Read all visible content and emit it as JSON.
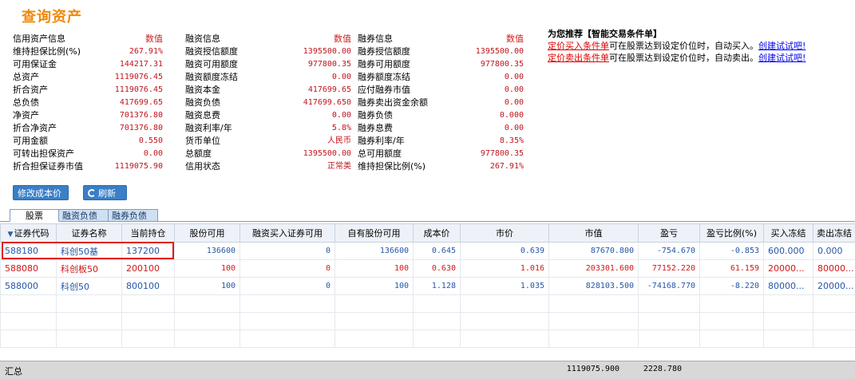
{
  "title": "查询资产",
  "info": {
    "col1": {
      "header": {
        "label": "信用资产信息",
        "value": "数值"
      },
      "rows": [
        {
          "label": "维持担保比例(%)",
          "value": "267.91%"
        },
        {
          "label": "可用保证金",
          "value": "144217.31"
        },
        {
          "label": "总资产",
          "value": "1119076.45"
        },
        {
          "label": "折合资产",
          "value": "1119076.45"
        },
        {
          "label": "总负债",
          "value": "417699.65"
        },
        {
          "label": "净资产",
          "value": "701376.80"
        },
        {
          "label": "折合净资产",
          "value": "701376.80"
        },
        {
          "label": "可用金额",
          "value": "0.550"
        },
        {
          "label": "可转出担保资产",
          "value": "0.00"
        },
        {
          "label": "折合担保证券市值",
          "value": "1119075.90"
        }
      ]
    },
    "col2": {
      "header": {
        "label": "融资信息",
        "value": "数值"
      },
      "rows": [
        {
          "label": "融资授信额度",
          "value": "1395500.00"
        },
        {
          "label": "融资可用额度",
          "value": "977800.35"
        },
        {
          "label": "融资额度冻结",
          "value": "0.00"
        },
        {
          "label": "融资本金",
          "value": "417699.65"
        },
        {
          "label": "融资负债",
          "value": "417699.650"
        },
        {
          "label": "融资息费",
          "value": "0.00"
        },
        {
          "label": "融资利率/年",
          "value": "5.8%"
        },
        {
          "label": "货币单位",
          "value": "人民币"
        },
        {
          "label": "总额度",
          "value": "1395500.00"
        },
        {
          "label": "信用状态",
          "value": "正常类"
        }
      ]
    },
    "col3": {
      "header": {
        "label": "融券信息",
        "value": "数值"
      },
      "rows": [
        {
          "label": "融券授信额度",
          "value": "1395500.00"
        },
        {
          "label": "融券可用额度",
          "value": "977800.35"
        },
        {
          "label": "融券额度冻结",
          "value": "0.00"
        },
        {
          "label": "应付融券市值",
          "value": "0.00"
        },
        {
          "label": "融券卖出资金余额",
          "value": "0.00"
        },
        {
          "label": "融券负债",
          "value": "0.000"
        },
        {
          "label": "融券息费",
          "value": "0.00"
        },
        {
          "label": "融券利率/年",
          "value": "8.35%"
        },
        {
          "label": "总可用额度",
          "value": "977800.35"
        },
        {
          "label": "维持担保比例(%)",
          "value": "267.91%"
        }
      ]
    }
  },
  "recommend": {
    "title": "为您推荐【智能交易条件单】",
    "line1": {
      "link": "定价买入条件单",
      "text": "可在股票达到设定价位时，自动买入。",
      "action": "创建试试吧!"
    },
    "line2": {
      "link": "定价卖出条件单",
      "text": "可在股票达到设定价位时，自动卖出。",
      "action": "创建试试吧!"
    }
  },
  "buttons": {
    "edit_cost": "修改成本价",
    "refresh": "刷新"
  },
  "tabs": [
    "股票",
    "融资负债",
    "融券负债"
  ],
  "table": {
    "columns": [
      "证券代码",
      "证券名称",
      "当前持仓",
      "股份可用",
      "融资买入证券可用",
      "自有股份可用",
      "成本价",
      "市价",
      "市值",
      "盈亏",
      "盈亏比例(%)",
      "买入冻结",
      "卖出冻结"
    ],
    "rows": [
      {
        "code": "588180",
        "name": "科创50基",
        "position": "137200",
        "available": "136600",
        "margin_available": "0",
        "own_available": "136600",
        "cost": "0.645",
        "price": "0.639",
        "market_value": "87670.800",
        "pnl": "-754.670",
        "pnl_ratio": "-0.853",
        "buy_frozen": "600.000",
        "sell_frozen": "0.000",
        "color": "blue"
      },
      {
        "code": "588080",
        "name": "科创板50",
        "position": "200100",
        "available": "100",
        "margin_available": "0",
        "own_available": "100",
        "cost": "0.630",
        "price": "1.016",
        "market_value": "203301.600",
        "pnl": "77152.220",
        "pnl_ratio": "61.159",
        "buy_frozen": "20000...",
        "sell_frozen": "80000...",
        "color": "red"
      },
      {
        "code": "588000",
        "name": "科创50",
        "position": "800100",
        "available": "100",
        "margin_available": "0",
        "own_available": "100",
        "cost": "1.128",
        "price": "1.035",
        "market_value": "828103.500",
        "pnl": "-74168.770",
        "pnl_ratio": "-8.220",
        "buy_frozen": "80000...",
        "sell_frozen": "20000...",
        "color": "blue"
      }
    ]
  },
  "summary": {
    "label": "汇总",
    "market_value": "1119075.900",
    "pnl": "2228.780"
  },
  "colors": {
    "accent_title": "#f0880a",
    "value_red": "#c0141c",
    "row_blue": "#2457a8",
    "row_red": "#d01818",
    "button_blue": "#3a7fc7",
    "highlight": "#e11818"
  }
}
